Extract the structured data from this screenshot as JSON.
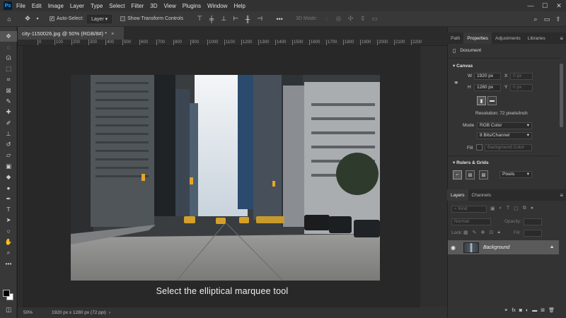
{
  "app": {
    "logo": "Ps",
    "menu": [
      "File",
      "Edit",
      "Image",
      "Layer",
      "Type",
      "Select",
      "Filter",
      "3D",
      "View",
      "Plugins",
      "Window",
      "Help"
    ],
    "window_controls": [
      "—",
      "☐",
      "✕"
    ]
  },
  "options_bar": {
    "auto_select_label": "Auto-Select:",
    "auto_select_target": "Layer",
    "show_transform_label": "Show Transform Controls",
    "mode_3d_label": "3D Mode:"
  },
  "document": {
    "tab_title": "city-1150026.jpg @ 50% (RGB/8#) *",
    "tab_close": "×",
    "ruler_ticks": [
      "0",
      "100",
      "200",
      "300",
      "400",
      "500",
      "600",
      "700",
      "800",
      "900",
      "1000",
      "1100",
      "1200",
      "1300",
      "1400",
      "1500",
      "1600",
      "1700",
      "1800",
      "1900",
      "2000",
      "2100",
      "2200"
    ],
    "caption": "Select the elliptical marquee tool"
  },
  "status_bar": {
    "zoom": "50%",
    "doc_info": "1920 px x 1280 px (72 ppi)"
  },
  "properties_panel": {
    "tabs": [
      "Path",
      "Properties",
      "Adjustments",
      "Libraries"
    ],
    "active_tab": "Properties",
    "document_label": "Document",
    "canvas_heading": "Canvas",
    "width_label": "W",
    "width_value": "1920 px",
    "height_label": "H",
    "height_value": "1280 px",
    "x_label": "X",
    "x_value": "0 px",
    "y_label": "Y",
    "y_value": "0 px",
    "resolution": "Resolution: 72 pixels/inch",
    "mode_label": "Mode",
    "mode_value": "RGB Color",
    "bits_value": "8 Bits/Channel",
    "fill_label": "Fill",
    "fill_value": "Background Color",
    "rulers_heading": "Rulers & Grids",
    "units_value": "Pixels"
  },
  "layers_panel": {
    "tabs": [
      "Layers",
      "Channels"
    ],
    "active_tab": "Layers",
    "kind_filter": "Kind",
    "blend_mode": "Normal",
    "opacity_label": "Opacity:",
    "lock_label": "Lock:",
    "fill_label": "Fill:",
    "layer_name": "Background"
  },
  "colors": {
    "accent": "#31a8ff",
    "panel_bg": "#333333",
    "selected_layer": "#5a5a5a"
  }
}
